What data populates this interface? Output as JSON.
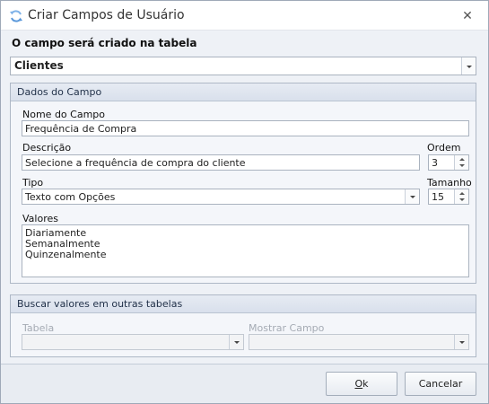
{
  "window": {
    "title": "Criar Campos de Usuário"
  },
  "table_section": {
    "heading": "O campo será criado na tabela",
    "selected_table": "Clientes"
  },
  "field_group": {
    "title": "Dados do Campo",
    "name_label": "Nome do Campo",
    "name_value": "Frequência de Compra",
    "description_label": "Descrição",
    "description_value": "Selecione a frequência de compra do cliente",
    "order_label": "Ordem",
    "order_value": "3",
    "type_label": "Tipo",
    "type_value": "Texto com Opções",
    "size_label": "Tamanho",
    "size_value": "15",
    "values_label": "Valores",
    "values": [
      "Diariamente",
      "Semanalmente",
      "Quinzenalmente"
    ]
  },
  "lookup_group": {
    "title": "Buscar valores em outras tabelas",
    "table_label": "Tabela",
    "table_value": "",
    "show_field_label": "Mostrar Campo",
    "show_field_value": ""
  },
  "buttons": {
    "ok_mnemonic": "O",
    "ok_rest": "k",
    "cancel": "Cancelar"
  }
}
